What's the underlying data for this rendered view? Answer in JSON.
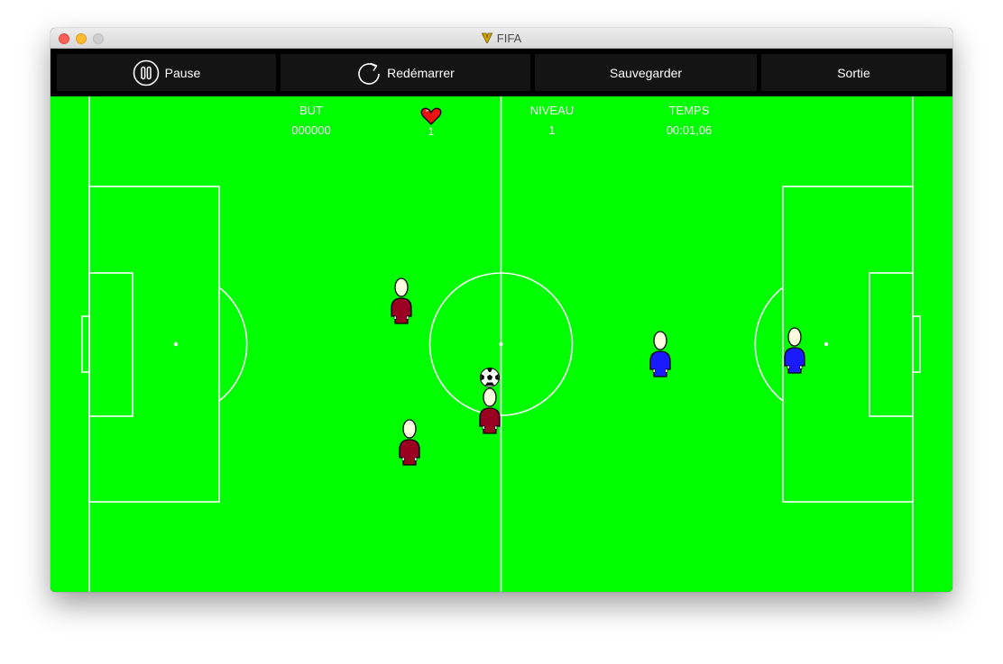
{
  "window": {
    "title": "FIFA"
  },
  "toolbar": {
    "pause_label": "Pause",
    "restart_label": "Redémarrer",
    "save_label": "Sauvegarder",
    "quit_label": "Sortie"
  },
  "hud": {
    "score_label": "BUT",
    "score_value": "000000",
    "lives_value": "1",
    "level_label": "NIVEAU",
    "level_value": "1",
    "time_label": "TEMPS",
    "time_value": "00:01,06"
  },
  "colors": {
    "pitch": "#00ff00",
    "lines": "#ffffff",
    "home_team": "#990022",
    "away_team": "#1a1aff",
    "toolbar_button": "#141414",
    "heart": "#ee1111"
  },
  "icons": {
    "pause": "pause-circle-icon",
    "restart": "restart-arrow-icon",
    "lives": "heart-icon",
    "ball": "soccer-ball-icon",
    "app": "app-logo-icon"
  }
}
